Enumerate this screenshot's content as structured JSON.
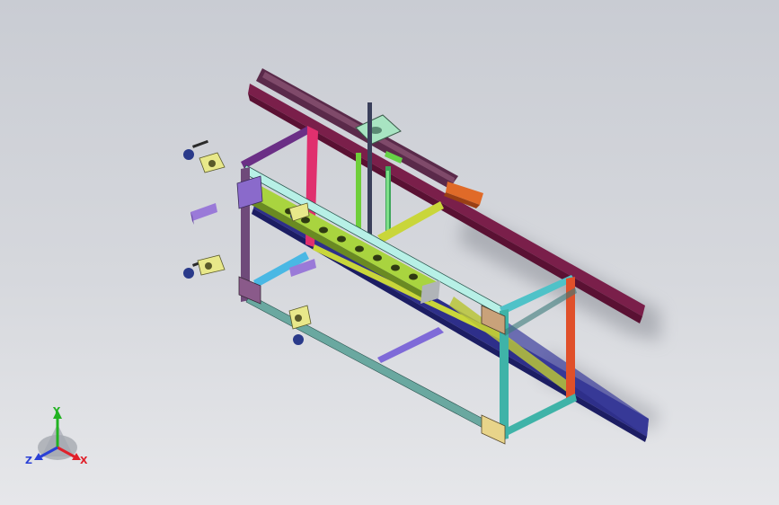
{
  "viewport": {
    "background_top": "#c9ccd3",
    "background_bottom": "#e6e7ea"
  },
  "triad": {
    "x_label": "X",
    "y_label": "Y",
    "z_label": "Z",
    "x_color": "#e0202a",
    "y_color": "#22b322",
    "z_color": "#2a40d6"
  },
  "icons": {
    "triad": "axis-triad-icon"
  }
}
